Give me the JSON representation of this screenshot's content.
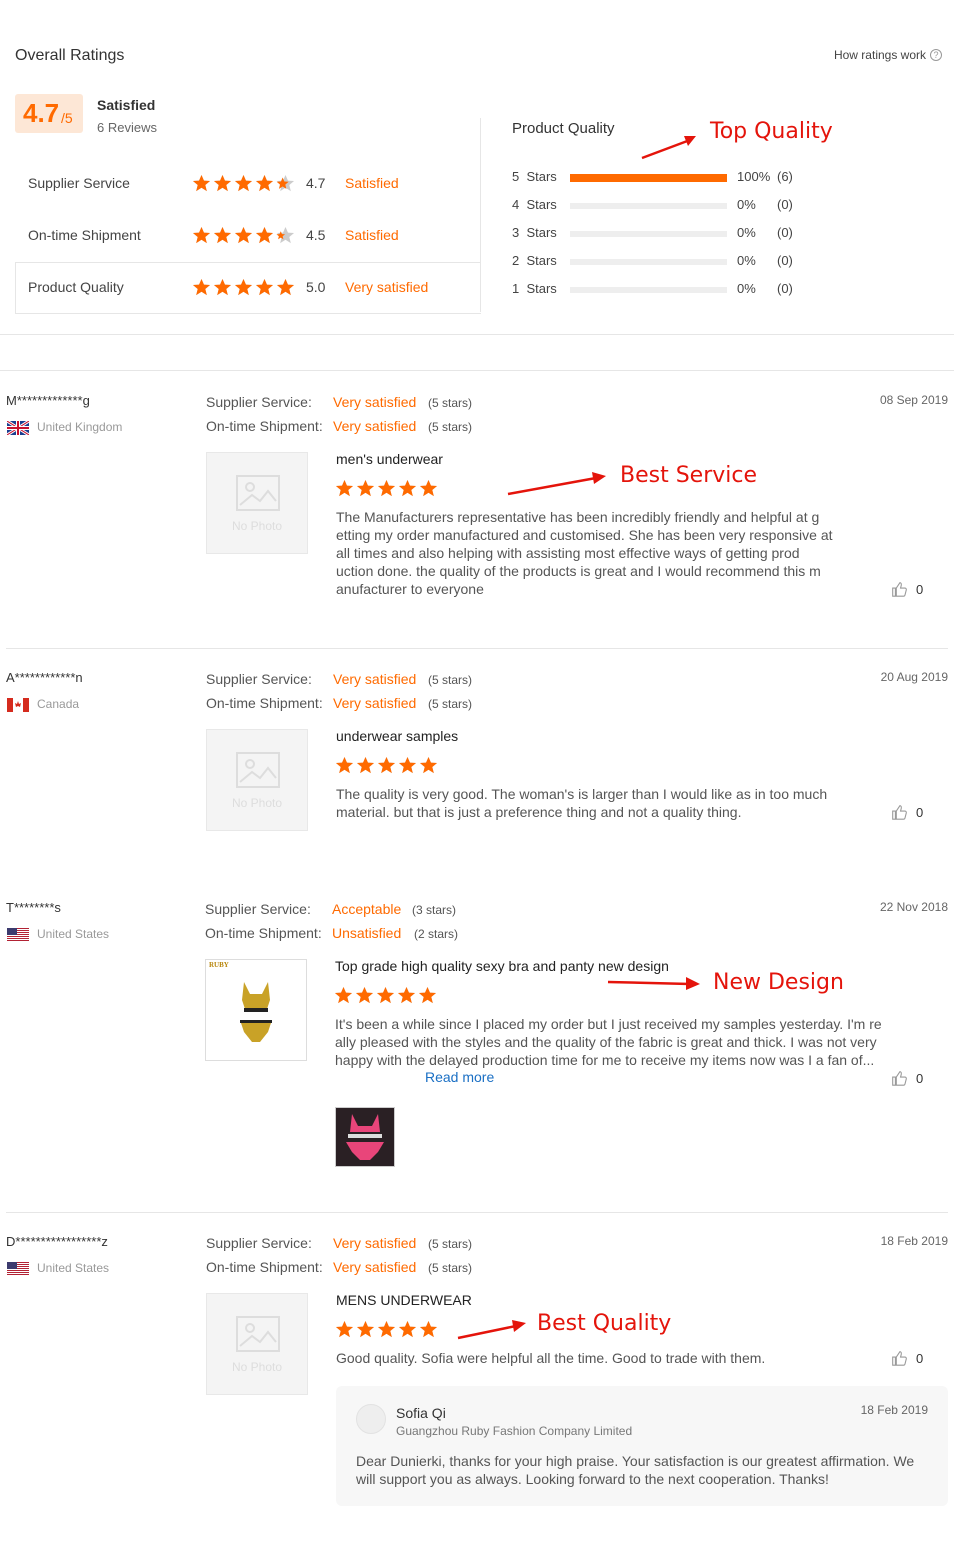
{
  "header": {
    "title": "Overall Ratings",
    "how_link": "How ratings work"
  },
  "summary": {
    "score": "4.7",
    "out_of": "/5",
    "label": "Satisfied",
    "reviews": "6 Reviews",
    "criteria": [
      {
        "name": "Supplier Service",
        "rating": 4.7,
        "score": "4.7",
        "label": "Satisfied"
      },
      {
        "name": "On-time Shipment",
        "rating": 4.5,
        "score": "4.5",
        "label": "Satisfied"
      },
      {
        "name": "Product Quality",
        "rating": 5.0,
        "score": "5.0",
        "label": "Very satisfied"
      }
    ]
  },
  "distribution": {
    "title": "Product Quality",
    "rows": [
      {
        "label": "5  Stars",
        "fraction": 1.0,
        "pct": "100%",
        "count": "(6)"
      },
      {
        "label": "4  Stars",
        "fraction": 0.0,
        "pct": "0%",
        "count": "(0)"
      },
      {
        "label": "3  Stars",
        "fraction": 0.0,
        "pct": "0%",
        "count": "(0)"
      },
      {
        "label": "2  Stars",
        "fraction": 0.0,
        "pct": "0%",
        "count": "(0)"
      },
      {
        "label": "1  Stars",
        "fraction": 0.0,
        "pct": "0%",
        "count": "(0)"
      }
    ]
  },
  "annotations": {
    "top_quality": "Top Quality",
    "best_service": "Best Service",
    "new_design": "New Design",
    "best_quality": "Best Quality"
  },
  "labels": {
    "supplier_service": "Supplier Service:",
    "ontime_shipment": "On-time Shipment:",
    "no_photo": "No Photo",
    "read_more": "Read more"
  },
  "reviews": [
    {
      "user": "M*************g",
      "country": "United Kingdom",
      "date": "08 Sep 2019",
      "service": "Very satisfied",
      "service_stars": "(5 stars)",
      "shipment": "Very satisfied",
      "shipment_stars": "(5 stars)",
      "product": "men's underwear",
      "text": "The Manufacturers representative has been incredibly friendly and helpful at g etting my order manufactured and customised. She has been very responsive at all times and also helping with assisting most effective ways of getting prod uction done. the quality of the products is great and I would recommend this m anufacturer to everyone",
      "likes": "0"
    },
    {
      "user": "A************n",
      "country": "Canada",
      "date": "20 Aug 2019",
      "service": "Very satisfied",
      "service_stars": "(5 stars)",
      "shipment": "Very satisfied",
      "shipment_stars": "(5 stars)",
      "product": "underwear samples",
      "text": "The quality is very good. The woman's is larger than I would like as in too much material. but that is just a preference thing and not a quality thing.",
      "likes": "0"
    },
    {
      "user": "T********s",
      "country": "United States",
      "date": "22 Nov 2018",
      "service": "Acceptable",
      "service_stars": "(3 stars)",
      "shipment": "Unsatisfied",
      "shipment_stars": "(2 stars)",
      "product": "Top grade high quality sexy bra and panty new design",
      "text": "It's been a while since I placed my order but I just received my samples yesterday. I'm re ally pleased with the styles and the quality of the fabric is great and thick. I was not very happy with the delayed production time for me to receive my items now was I a fan of...",
      "product_brand": "RUBY",
      "likes": "0"
    },
    {
      "user": "D*****************z",
      "country": "United States",
      "date": "18 Feb 2019",
      "service": "Very satisfied",
      "service_stars": "(5 stars)",
      "shipment": "Very satisfied",
      "shipment_stars": "(5 stars)",
      "product": "MENS UNDERWEAR",
      "text": "Good quality. Sofia were helpful all the time. Good to trade with them.",
      "likes": "0",
      "reply": {
        "name": "Sofia Qi",
        "company": "Guangzhou Ruby Fashion Company Limited",
        "date": "18 Feb 2019",
        "text": "Dear Dunierki, thanks for your high praise. Your satisfaction is our greatest affirmation. We will support you as always. Looking forward to the next cooperation. Thanks!"
      }
    }
  ],
  "colors": {
    "accent": "#ff6a00",
    "annotation": "#e4140b"
  }
}
